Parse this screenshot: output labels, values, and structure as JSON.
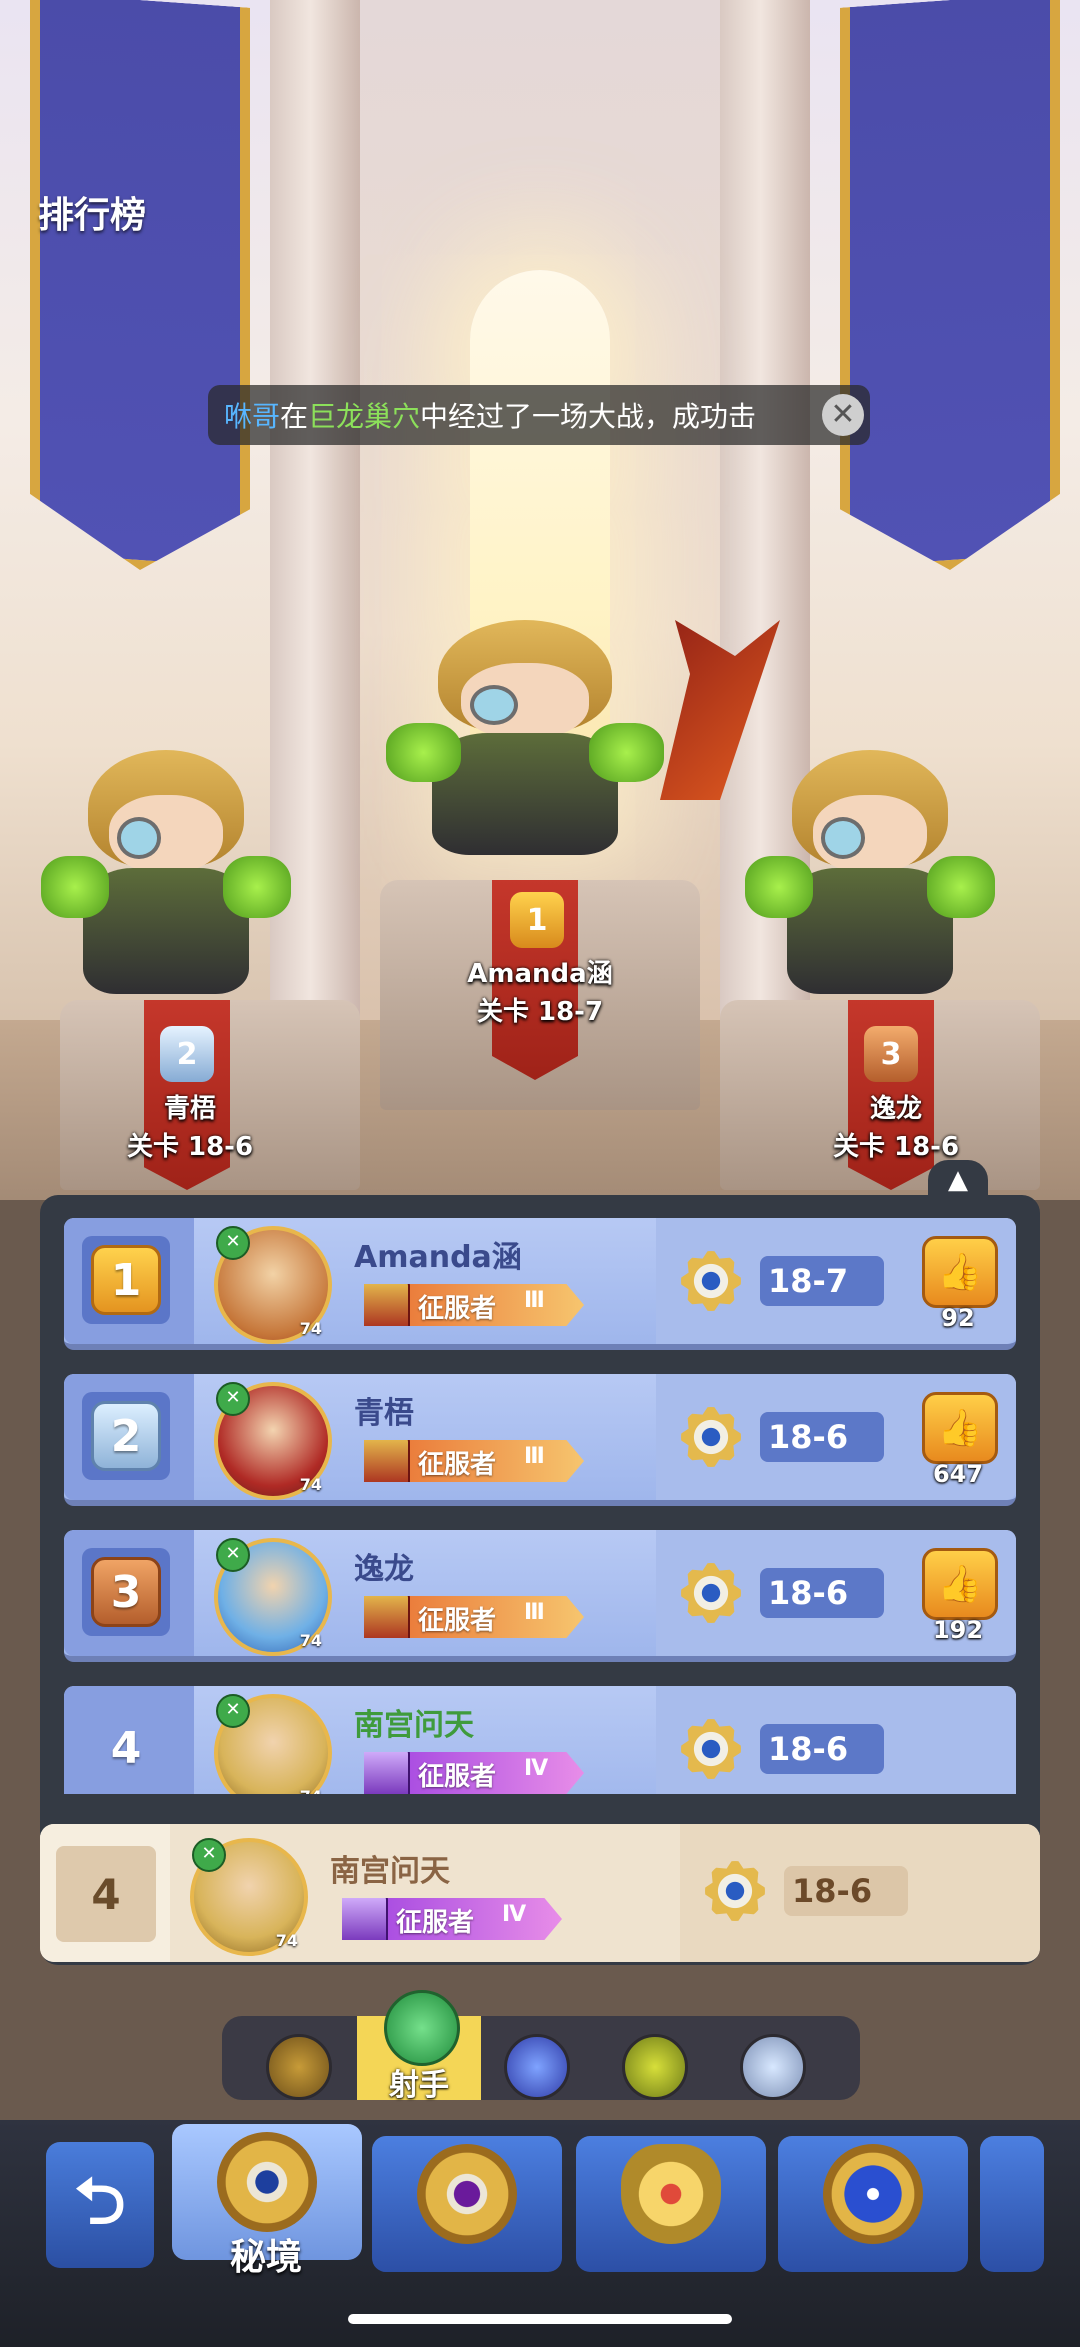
{
  "header": {
    "title": "排行榜"
  },
  "ticker": {
    "player": "咻哥",
    "text1": "在",
    "place": "巨龙巢穴",
    "text2": "中经过了一场大战，成功击",
    "close_icon": "close-icon"
  },
  "podium": [
    {
      "rank": "1",
      "name": "Amanda涵",
      "stage": "关卡 18-7"
    },
    {
      "rank": "2",
      "name": "青梧",
      "stage": "关卡 18-6"
    },
    {
      "rank": "3",
      "name": "逸龙",
      "stage": "关卡 18-6"
    }
  ],
  "list": {
    "collapse_icon": "chevron-up-icon",
    "rows": [
      {
        "rank": "1",
        "name": "Amanda涵",
        "level": "74",
        "title": "征服者",
        "tier": "Ⅲ",
        "stage": "18-7",
        "likes": "92"
      },
      {
        "rank": "2",
        "name": "青梧",
        "level": "74",
        "title": "征服者",
        "tier": "Ⅲ",
        "stage": "18-6",
        "likes": "647"
      },
      {
        "rank": "3",
        "name": "逸龙",
        "level": "74",
        "title": "征服者",
        "tier": "Ⅲ",
        "stage": "18-6",
        "likes": "192"
      },
      {
        "rank": "4",
        "name": "南宫问天",
        "level": "74",
        "title": "征服者",
        "tier": "Ⅳ",
        "stage": "18-6",
        "likes": ""
      }
    ]
  },
  "me": {
    "rank": "4",
    "name": "南宫问天",
    "level": "74",
    "title": "征服者",
    "tier": "Ⅳ",
    "stage": "18-6"
  },
  "class_tabs": {
    "items": [
      "axe-icon",
      "bow-icon",
      "staff-icon",
      "sword-icon",
      "cross-icon"
    ],
    "selected_label": "射手"
  },
  "modes": {
    "back_icon": "back-arrow-icon",
    "selected_label": "秘境",
    "items": [
      "secret-realm-emblem",
      "purple-emblem",
      "crown-emblem",
      "star-emblem"
    ]
  },
  "colors": {
    "accent_gold": "#f4d656",
    "row_blue": "#b7c9f4",
    "me_row": "#efe3cf"
  }
}
